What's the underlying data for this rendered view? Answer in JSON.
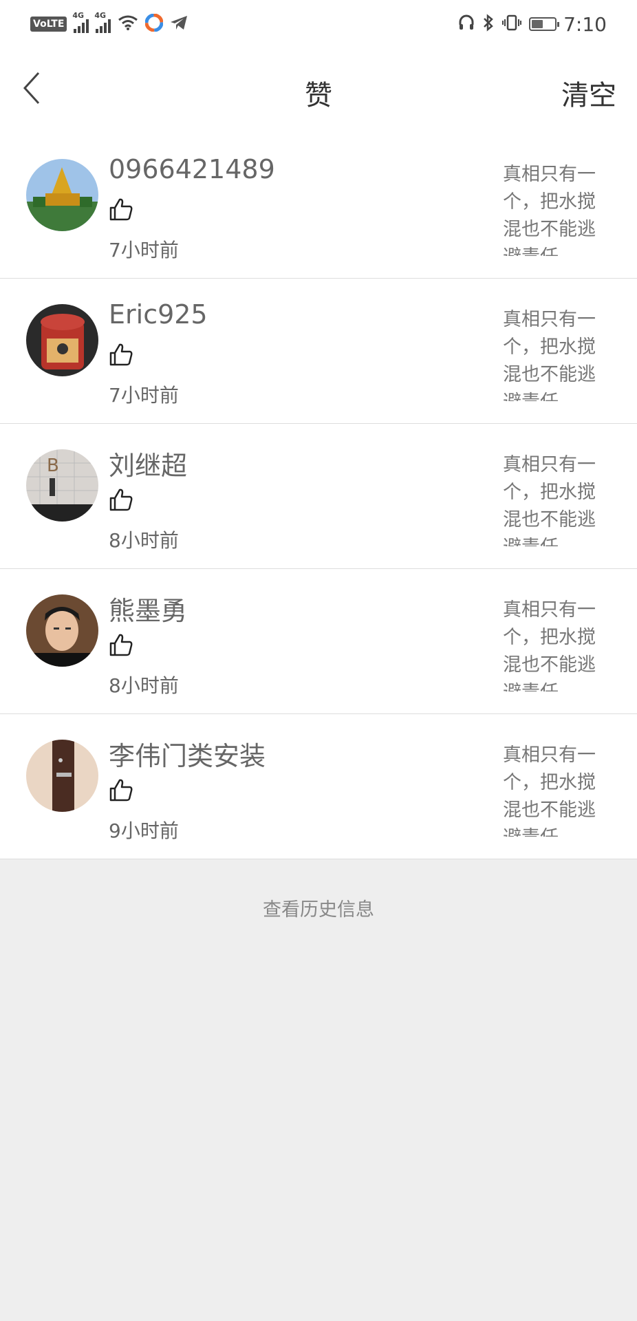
{
  "status_bar": {
    "volte": "VoLTE",
    "net1": "4G",
    "net2": "4G",
    "time": "7:10",
    "battery_level": 0.5
  },
  "header": {
    "title": "赞",
    "clear_label": "清空"
  },
  "items": [
    {
      "name": "0966421489",
      "time": "7小时前",
      "excerpt": "真相只有一个，把水搅混也不能逃避责任"
    },
    {
      "name": "Eric925",
      "time": "7小时前",
      "excerpt": "真相只有一个，把水搅混也不能逃避责任"
    },
    {
      "name": "刘继超",
      "time": "8小时前",
      "excerpt": "真相只有一个，把水搅混也不能逃避责任"
    },
    {
      "name": "熊墨勇",
      "time": "8小时前",
      "excerpt": "真相只有一个，把水搅混也不能逃避责任"
    },
    {
      "name": "李伟门类安装",
      "time": "9小时前",
      "excerpt": "真相只有一个，把水搅混也不能逃避责任"
    }
  ],
  "footer": {
    "history_label": "查看历史信息"
  }
}
